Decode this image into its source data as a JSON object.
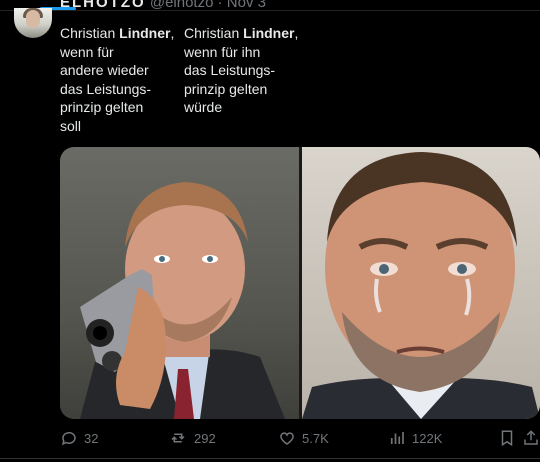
{
  "tweet": {
    "author_name": "ELHOTZO",
    "handle": "@elhotzo",
    "separator": "·",
    "date": "Nov 3",
    "left_caption": {
      "line1_pre": "Christian ",
      "line1_bold": "Lindner",
      "line1_post": ",",
      "rest": "wenn für\nandere wieder\ndas Leistungs-\nprinzip gelten\nsoll"
    },
    "right_caption": {
      "line1_pre": "Christian ",
      "line1_bold": "Lindner",
      "line1_post": ",",
      "rest": "wenn für ihn\ndas Leistungs-\nprinzip gelten\nwürde"
    }
  },
  "actions": {
    "replies": "32",
    "reposts": "292",
    "likes": "5.7K",
    "views": "122K"
  },
  "icons": [
    "reply-icon",
    "repost-icon",
    "like-icon",
    "views-icon",
    "bookmark-icon",
    "share-icon"
  ],
  "colors": {
    "accent": "#1d9bf0",
    "muted": "#71767b",
    "text": "#e7e9ea",
    "background": "#000000"
  }
}
